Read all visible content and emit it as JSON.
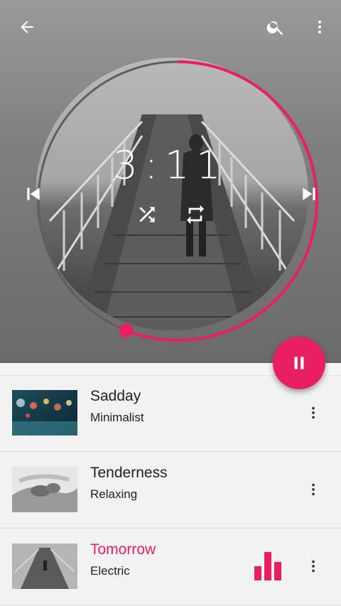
{
  "player": {
    "time": "3:11",
    "progress_fraction": 0.56
  },
  "colors": {
    "accent": "#e91e63",
    "hero_bg": "#7f7f7f"
  },
  "icons": {
    "back": "arrow-back-icon",
    "search": "search-icon",
    "more": "more-vert-icon",
    "shuffle": "shuffle-icon",
    "repeat": "repeat-icon",
    "prev": "skip-previous-icon",
    "next": "skip-next-icon",
    "pause": "pause-icon",
    "equalizer": "equalizer-icon"
  },
  "playlist": [
    {
      "title": "Sadday",
      "subtitle": "Minimalist",
      "active": false
    },
    {
      "title": "Tenderness",
      "subtitle": "Relaxing",
      "active": false
    },
    {
      "title": "Tomorrow",
      "subtitle": "Electric",
      "active": true
    }
  ]
}
